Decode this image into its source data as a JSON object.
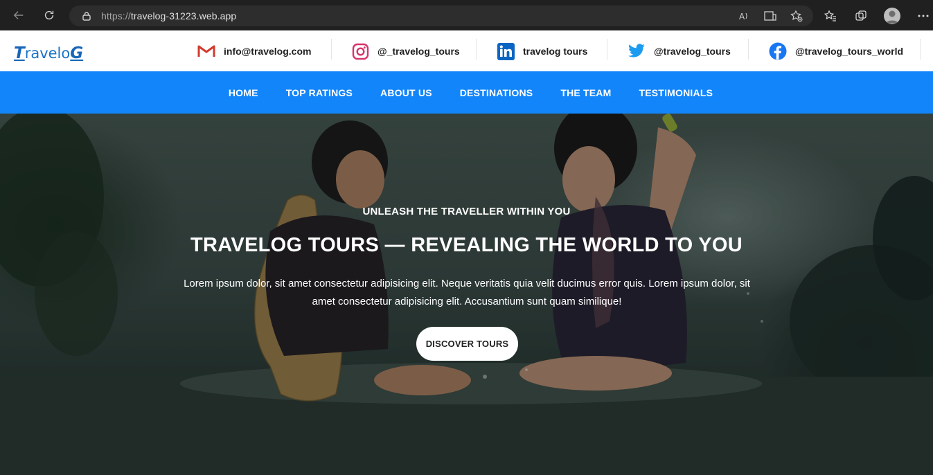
{
  "browser": {
    "url_protocol": "https://",
    "url_host": "travelog-31223.web.app"
  },
  "header": {
    "logo_first": "T",
    "logo_middle": "ravelo",
    "logo_last": "G",
    "contacts": [
      {
        "icon": "gmail-icon",
        "label": "info@travelog.com"
      },
      {
        "icon": "instagram-icon",
        "label": "@_travelog_tours"
      },
      {
        "icon": "linkedin-icon",
        "label": "travelog tours"
      },
      {
        "icon": "twitter-icon",
        "label": "@travelog_tours"
      },
      {
        "icon": "facebook-icon",
        "label": "@travelog_tours_world"
      }
    ]
  },
  "nav": {
    "items": [
      "HOME",
      "TOP RATINGS",
      "ABOUT US",
      "DESTINATIONS",
      "THE TEAM",
      "TESTIMONIALS"
    ]
  },
  "hero": {
    "kicker": "UNLEASH THE TRAVELLER WITHIN YOU",
    "title": "TRAVELOG TOURS — REVEALING THE WORLD TO YOU",
    "text": "Lorem ipsum dolor, sit amet consectetur adipisicing elit. Neque veritatis quia velit ducimus error quis. Lorem ipsum dolor, sit amet consectetur adipisicing elit. Accusantium sunt quam similique!",
    "button_label": "DISCOVER TOURS"
  },
  "colors": {
    "nav_bg": "#1285fa",
    "logo": "#1766b8",
    "gmail_red": "#d23a2d",
    "instagram": "#d6336c",
    "linkedin": "#0a66c2",
    "twitter": "#1d9bf0",
    "facebook": "#1877f2"
  }
}
